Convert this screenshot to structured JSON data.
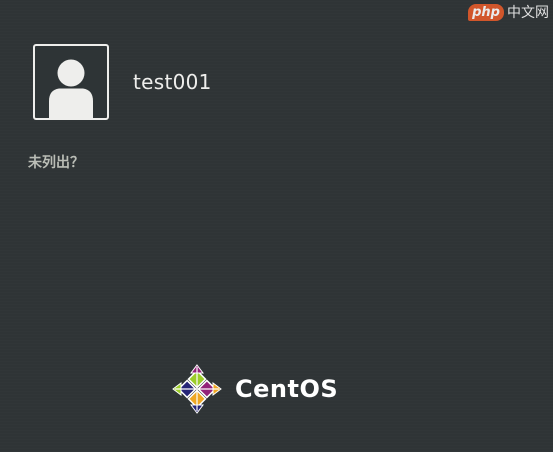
{
  "users": [
    {
      "name": "test001"
    }
  ],
  "not_listed_label": "未列出？",
  "brand": {
    "name": "CentOS",
    "logo_icon": "centos-logo-icon"
  },
  "watermark": {
    "badge": "php",
    "text": "中文网"
  },
  "colors": {
    "background": "#2f3436",
    "text": "#eeeeec",
    "muted_text": "#babdb6"
  }
}
